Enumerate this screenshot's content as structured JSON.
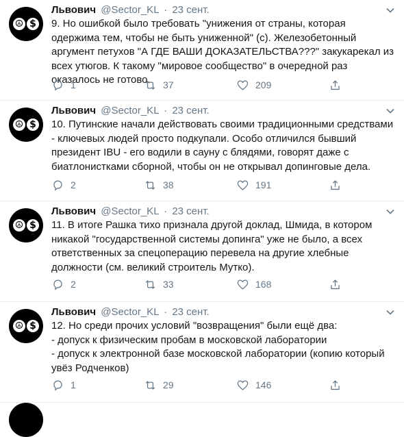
{
  "tweets": [
    {
      "name": "Львович",
      "handle": "@Sector_KL",
      "sep": "·",
      "date": "23 сент.",
      "text": "9. Но ошибкой было требовать \"унижения от страны, которая одержима тем, чтобы не быть униженной\" (с). Железобетонный аргумент петухов \"А ГДЕ ВАШИ ДОКАЗАТЕЛЬСТВА???\" закукарекал из всех утюгов. К такому \"мировое сообщество\" в очередной раз оказалось не готово.",
      "replies": "1",
      "retweets": "37",
      "likes": "209"
    },
    {
      "name": "Львович",
      "handle": "@Sector_KL",
      "sep": "·",
      "date": "23 сент.",
      "text": "10. Путинские начали действовать своими традиционными средствами - ключевых людей просто подкупали. Особо отличился бывший президент IBU - его водили в сауну с блядями, говорят даже с биатлонистками сборной, чтобы он не открывал допинговые дела.",
      "replies": "2",
      "retweets": "38",
      "likes": "191"
    },
    {
      "name": "Львович",
      "handle": "@Sector_KL",
      "sep": "·",
      "date": "23 сент.",
      "text": "11. В итоге Рашка тихо признала другой доклад, Шмида, в котором никакой \"государственной системы допинга\" уже не было, а всех ответственных за спецоперацию перевела на другие хлебные должности (см. великий строитель Мутко).",
      "replies": "2",
      "retweets": "33",
      "likes": "168"
    },
    {
      "name": "Львович",
      "handle": "@Sector_KL",
      "sep": "·",
      "date": "23 сент.",
      "text": "12. Но среди прочих условий \"возвращения\" были ещё два:\n- допуск к физическим пробам в московской лаборатории\n- допуск к электронной базе московской лаборатории (копию который увёз Родченков)",
      "replies": "1",
      "retweets": "29",
      "likes": "146"
    }
  ],
  "avatar": {
    "left_symbol": "☮",
    "right_symbol": "$"
  },
  "colors": {
    "text": "#14171a",
    "muted": "#657786",
    "divider": "#e6ecf0"
  },
  "icons": [
    "reply-icon",
    "retweet-icon",
    "like-icon",
    "share-icon",
    "chevron-down-icon"
  ]
}
